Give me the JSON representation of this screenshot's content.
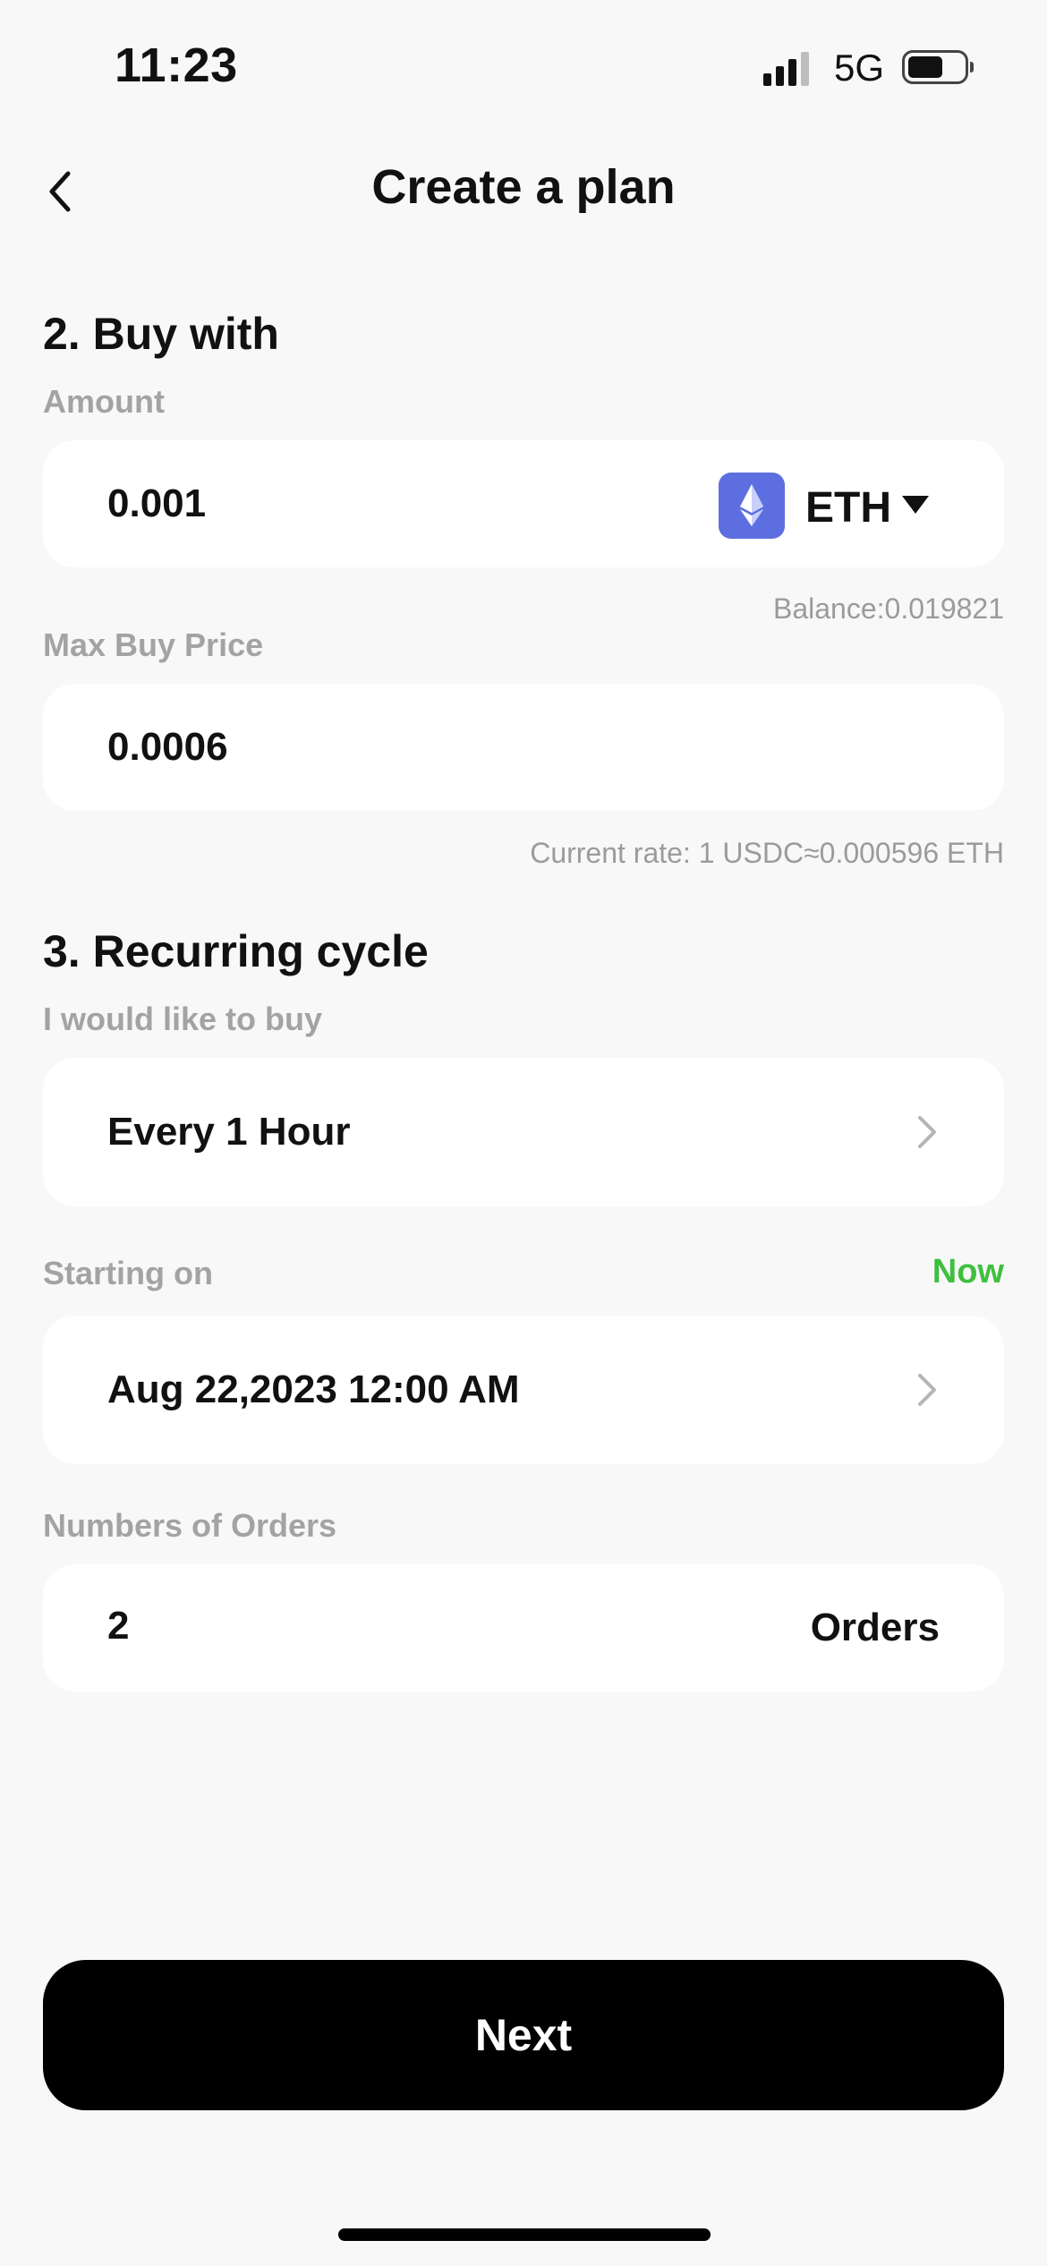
{
  "status_bar": {
    "time": "11:23",
    "network": "5G"
  },
  "header": {
    "title": "Create a plan",
    "back_icon": "chevron-left-icon"
  },
  "buy_with": {
    "section_title": "2. Buy with",
    "amount_label": "Amount",
    "amount_value": "0.001",
    "currency": "ETH",
    "currency_icon": "ethereum-icon",
    "balance_text": "Balance:0.019821",
    "max_price_label": "Max Buy Price",
    "max_price_value": "0.0006",
    "rate_text": "Current rate: 1 USDC≈0.000596 ETH"
  },
  "recurring": {
    "section_title": "3. Recurring cycle",
    "frequency_label": "I would like to buy",
    "frequency_value": "Every 1 Hour",
    "start_label": "Starting on",
    "start_now": "Now",
    "start_value": "Aug 22,2023 12:00 AM",
    "orders_label": "Numbers of Orders",
    "orders_value": "2",
    "orders_unit": "Orders"
  },
  "footer": {
    "next_label": "Next"
  },
  "colors": {
    "background": "#f8f8f8",
    "card": "#ffffff",
    "accent_green": "#3fbf3f",
    "eth_badge": "#5d6fe0",
    "button": "#000000"
  }
}
